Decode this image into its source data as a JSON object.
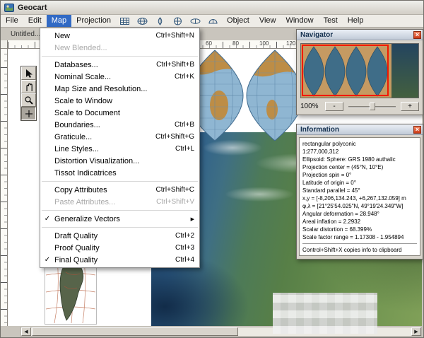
{
  "window": {
    "title": "Geocart"
  },
  "menubar": {
    "items": [
      "File",
      "Edit",
      "Map",
      "Projection",
      "Object",
      "View",
      "Window",
      "Test",
      "Help"
    ],
    "active": "Map"
  },
  "document": {
    "title": "Untitled...",
    "ruler_numbers": [
      "60",
      "80",
      "100",
      "120"
    ]
  },
  "map_menu": {
    "items": [
      {
        "label": "New",
        "shortcut": "Ctrl+Shift+N"
      },
      {
        "label": "New Blended...",
        "shortcut": "",
        "state": "disabled"
      },
      {
        "label": "Databases...",
        "shortcut": "Ctrl+Shift+B"
      },
      {
        "label": "Nominal Scale...",
        "shortcut": "Ctrl+K"
      },
      {
        "label": "Map Size and Resolution...",
        "shortcut": ""
      },
      {
        "label": "Scale to Window",
        "shortcut": ""
      },
      {
        "label": "Scale to Document",
        "shortcut": ""
      },
      {
        "label": "Boundaries...",
        "shortcut": "Ctrl+B"
      },
      {
        "label": "Graticule...",
        "shortcut": "Ctrl+Shift+G"
      },
      {
        "label": "Line Styles...",
        "shortcut": "Ctrl+L"
      },
      {
        "label": "Distortion Visualization...",
        "shortcut": ""
      },
      {
        "label": "Tissot Indicatrices",
        "shortcut": ""
      },
      {
        "label": "Copy Attributes",
        "shortcut": "Ctrl+Shift+C"
      },
      {
        "label": "Paste Attributes...",
        "shortcut": "Ctrl+Shift+V",
        "state": "disabled"
      },
      {
        "label": "Generalize Vectors",
        "shortcut": "",
        "checked": true,
        "submenu": true
      },
      {
        "label": "Draft Quality",
        "shortcut": "Ctrl+2"
      },
      {
        "label": "Proof Quality",
        "shortcut": "Ctrl+3"
      },
      {
        "label": "Final Quality",
        "shortcut": "Ctrl+4",
        "checked": true
      }
    ]
  },
  "navigator": {
    "title": "Navigator",
    "zoom_label": "100%",
    "minus_label": "-",
    "plus_label": "+"
  },
  "information": {
    "title": "Information",
    "lines": [
      "rectangular polyconic",
      "1:277,000,312",
      "Ellipsoid: Sphere: GRS 1980 authalic",
      "Projection center = (45°N, 10°E)",
      "Projection spin = 0°",
      "Latitude of origin = 0°",
      "Standard parallel = 45°",
      "x,y = [-8,206,134.243, +6,267,132.059] m",
      "φ,λ = [21°25′54.025″N, 49°19′24.349″W]",
      "Angular deformation = 28.948°",
      "Areal inflation = 2.2932",
      "Scalar distortion = 68.399%",
      "Scale factor range = 1.17308 - 1.954894"
    ],
    "footer": "Control+Shift+X copies info to clipboard"
  },
  "glyphs": {
    "check": "✓",
    "submenu_arrow": "▶",
    "close": "×",
    "scroll_left": "◀",
    "scroll_right": "▶"
  },
  "colors": {
    "menu_highlight": "#316ac5",
    "view_rect": "#f21800",
    "close_button": "#cb3a17"
  }
}
